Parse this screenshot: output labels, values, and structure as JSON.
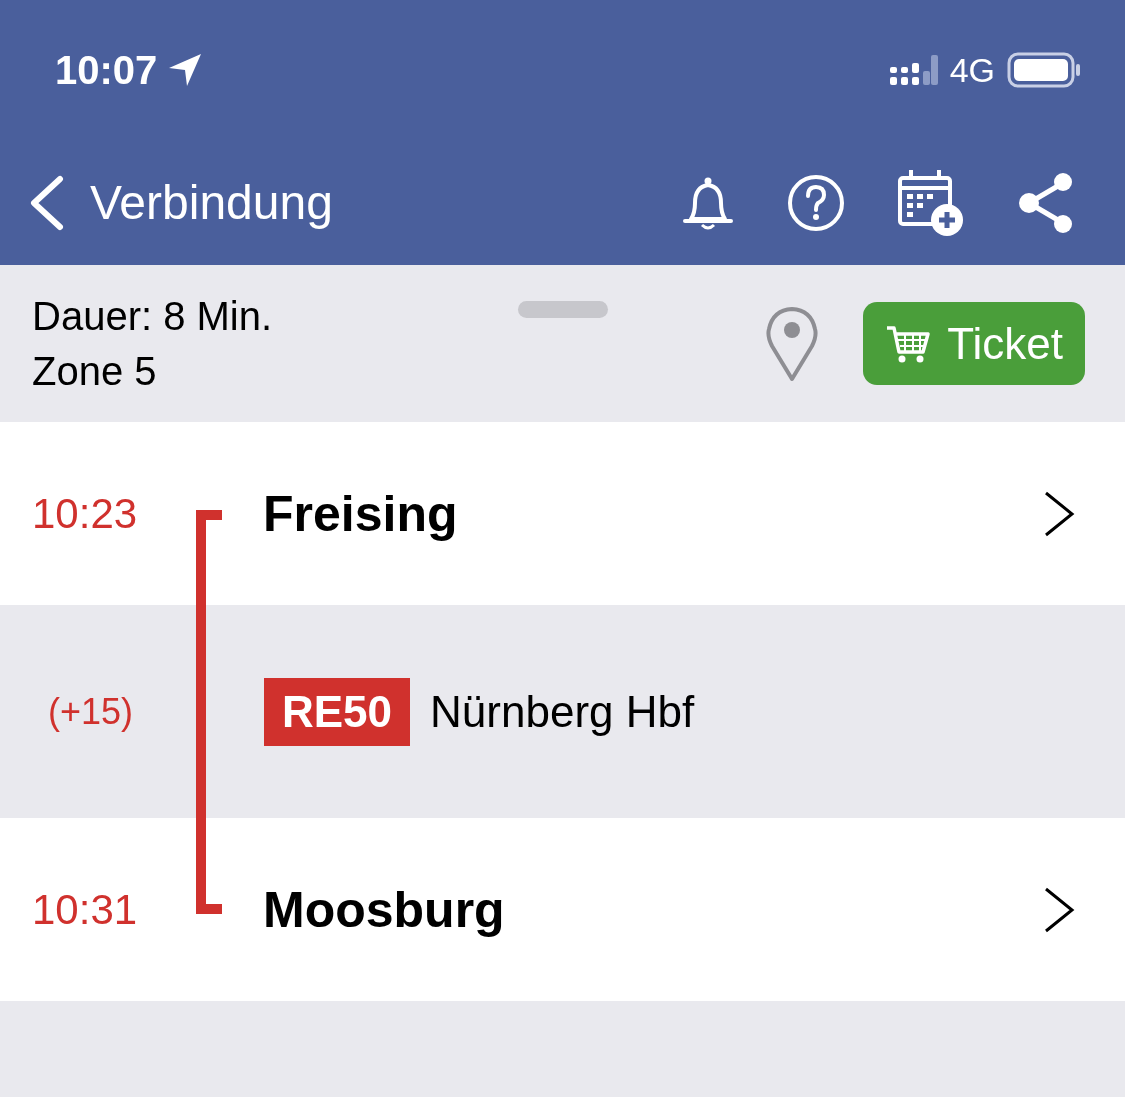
{
  "status_bar": {
    "time": "10:07",
    "network": "4G"
  },
  "nav_bar": {
    "back_label": "Verbindung"
  },
  "summary": {
    "duration": "Dauer: 8 Min.",
    "zone": "Zone 5",
    "ticket_button": "Ticket"
  },
  "trip": [
    {
      "kind": "stop",
      "time": "10:23",
      "name": "Freising"
    },
    {
      "kind": "leg",
      "delay": "(+15)",
      "line": "RE50",
      "direction": "Nürnberg Hbf"
    },
    {
      "kind": "stop",
      "time": "10:31",
      "name": "Moosburg"
    }
  ]
}
